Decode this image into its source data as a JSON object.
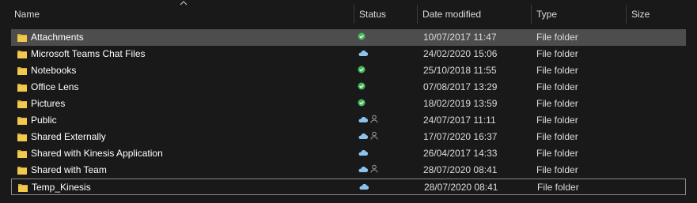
{
  "columns": {
    "name": "Name",
    "status": "Status",
    "date_modified": "Date modified",
    "type": "Type",
    "size": "Size"
  },
  "sort": {
    "column": "name",
    "direction": "ascending",
    "icon": "sort-up-chevron-icon"
  },
  "colors": {
    "background": "#191919",
    "selected_row": "#4d4d4d",
    "synced_green": "#3fba55",
    "cloud_blue": "#8cc3ee",
    "folder_yellow": "#f2c94c"
  },
  "files": [
    {
      "name": "Attachments",
      "status": "synced",
      "date": "10/07/2017 11:47",
      "type": "File folder",
      "shared": false,
      "selected": true
    },
    {
      "name": "Microsoft Teams Chat Files",
      "status": "cloud",
      "date": "24/02/2020 15:06",
      "type": "File folder",
      "shared": false
    },
    {
      "name": "Notebooks",
      "status": "synced",
      "date": "25/10/2018 11:55",
      "type": "File folder",
      "shared": false
    },
    {
      "name": "Office Lens",
      "status": "synced",
      "date": "07/08/2017 13:29",
      "type": "File folder",
      "shared": false
    },
    {
      "name": "Pictures",
      "status": "synced",
      "date": "18/02/2019 13:59",
      "type": "File folder",
      "shared": false
    },
    {
      "name": "Public",
      "status": "cloud",
      "date": "24/07/2017 11:11",
      "type": "File folder",
      "shared": true
    },
    {
      "name": "Shared Externally",
      "status": "cloud",
      "date": "17/07/2020 16:37",
      "type": "File folder",
      "shared": true
    },
    {
      "name": "Shared with Kinesis Application",
      "status": "cloud",
      "date": "26/04/2017 14:33",
      "type": "File folder",
      "shared": false
    },
    {
      "name": "Shared with Team",
      "status": "cloud",
      "date": "28/07/2020 08:41",
      "type": "File folder",
      "shared": true
    },
    {
      "name": "Temp_Kinesis",
      "status": "cloud",
      "date": "28/07/2020 08:41",
      "type": "File folder",
      "shared": false,
      "focused": true
    }
  ]
}
